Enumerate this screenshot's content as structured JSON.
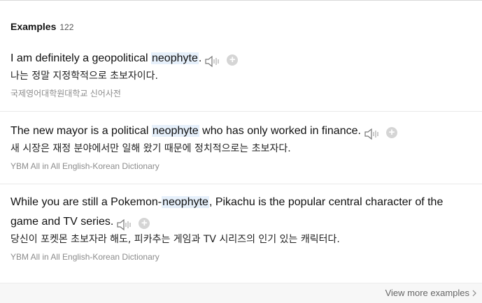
{
  "header": {
    "title": "Examples",
    "count": "122"
  },
  "examples": [
    {
      "en_before": "I am definitely a geopolitical ",
      "en_highlight": "neophyte",
      "en_after": ".",
      "ko": "나는 정말 지정학적으로 초보자이다.",
      "source": "국제영어대학원대학교 신어사전"
    },
    {
      "en_before": "The new mayor is a political ",
      "en_highlight": "neophyte",
      "en_after": " who has only worked in finance.",
      "ko": "새 시장은 재정 분야에서만 일해 왔기 때문에 정치적으로는 초보자다.",
      "source": "YBM All in All English-Korean Dictionary"
    },
    {
      "en_before": "While you are still a Pokemon-",
      "en_highlight": "neophyte",
      "en_after": ", Pikachu is the popular central character of the game and TV series.",
      "ko": "당신이 포켓몬 초보자라 해도, 피카추는 게임과 TV 시리즈의 인기 있는 캐릭터다.",
      "source": "YBM All in All English-Korean Dictionary"
    }
  ],
  "icons": {
    "speaker": "speaker-icon",
    "add": "plus-circle-icon",
    "chevron": "chevron-right-icon"
  },
  "add_symbol": "+",
  "footer": {
    "view_more_label": "View more examples"
  },
  "colors": {
    "highlight": "#e6f0fb",
    "source_text": "#8c8c8c",
    "add_button": "#d5d5d5"
  }
}
